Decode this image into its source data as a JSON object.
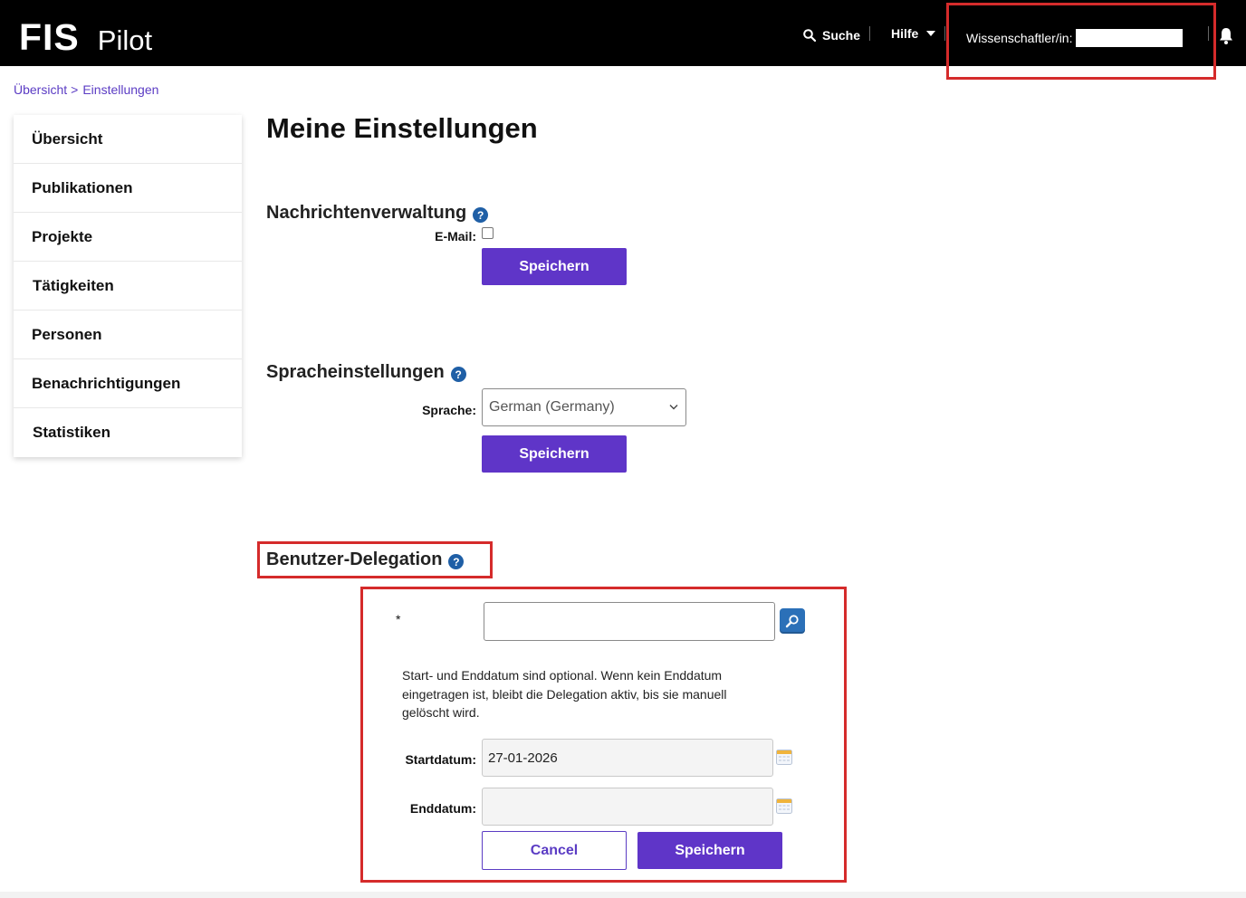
{
  "header": {
    "logo_main": "FIS",
    "logo_sub": "Pilot",
    "search_label": "Suche",
    "help_label": "Hilfe",
    "user_label": "Wissenschaftler/in:"
  },
  "breadcrumb": {
    "items": [
      "Übersicht",
      "Einstellungen"
    ],
    "separator": ">"
  },
  "sidebar": {
    "items": [
      {
        "label": "Übersicht"
      },
      {
        "label": "Publikationen"
      },
      {
        "label": "Projekte"
      },
      {
        "label": "Tätigkeiten"
      },
      {
        "label": "Personen"
      },
      {
        "label": "Benachrichtigungen"
      },
      {
        "label": "Statistiken"
      }
    ]
  },
  "main": {
    "title": "Meine Einstellungen",
    "messages": {
      "title": "Nachrichtenverwaltung",
      "email_label": "E-Mail:",
      "email_checked": false,
      "save_label": "Speichern"
    },
    "language": {
      "title": "Spracheinstellungen",
      "label": "Sprache:",
      "selected": "German (Germany)",
      "save_label": "Speichern"
    },
    "delegation": {
      "title": "Benutzer-Delegation",
      "required_marker": "*",
      "user_value": "",
      "info": "Start- und Enddatum sind optional. Wenn kein Enddatum eingetragen ist, bleibt die Delegation aktiv, bis sie manuell gelöscht wird.",
      "start_label": "Startdatum:",
      "start_value": "27-01-2026",
      "end_label": "Enddatum:",
      "end_value": "",
      "cancel_label": "Cancel",
      "save_label": "Speichern"
    },
    "help_glyph": "?"
  },
  "colors": {
    "header_bg": "#000000",
    "primary": "#5f35c8",
    "link": "#5b3cc4",
    "highlight": "#d52b2b",
    "help_icon": "#1f5fa6"
  }
}
